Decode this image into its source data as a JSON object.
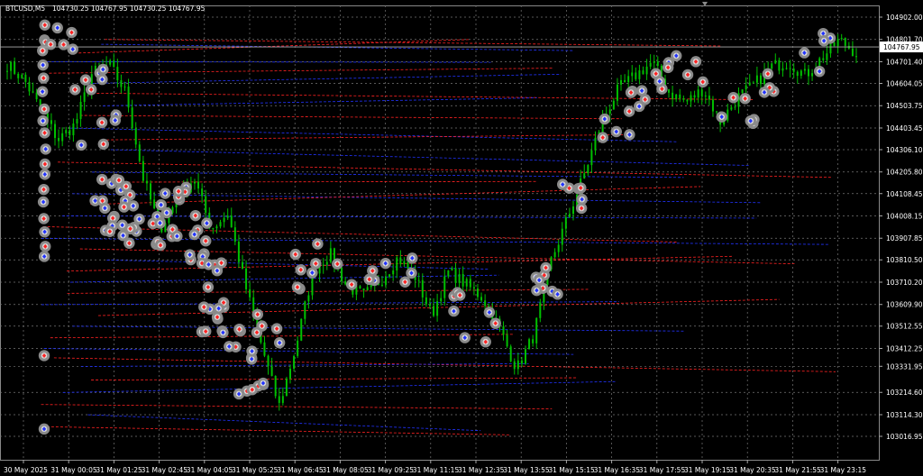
{
  "header": {
    "symbol": "BTCUSD,M5",
    "ohlc": "104730.25 104767.95 104730.25 104767.95"
  },
  "colors": {
    "background": "#000000",
    "grid": "#777777",
    "candle": "#00c000",
    "buy_line": "#2233ff",
    "sell_line": "#ff2222",
    "marker_ring": "#8a8a8a",
    "bid_line": "#aaaaaa"
  },
  "chart_data": {
    "type": "candlestick",
    "symbol": "BTCUSD",
    "timeframe": "M5",
    "current_price": 104767.95,
    "price_label": "104767.95",
    "ylim": [
      103016.95,
      104902.0
    ],
    "y_ticks": [
      "104902.00",
      "104801.70",
      "104701.40",
      "104604.05",
      "104503.75",
      "104403.45",
      "104306.10",
      "104205.80",
      "104108.45",
      "104008.15",
      "103907.85",
      "103810.50",
      "103710.20",
      "103609.90",
      "103512.55",
      "103412.25",
      "103331.95",
      "103214.60",
      "103114.30",
      "103016.95"
    ],
    "x_ticks": [
      "30 May 2025",
      "31 May 00:05",
      "31 May 01:25",
      "31 May 02:45",
      "31 May 04:05",
      "31 May 05:25",
      "31 May 06:45",
      "31 May 08:05",
      "31 May 09:25",
      "31 May 11:15",
      "31 May 12:35",
      "31 May 13:55",
      "31 May 15:15",
      "31 May 16:35",
      "31 May 17:55",
      "31 May 19:15",
      "31 May 20:35",
      "31 May 21:55",
      "31 May 23:15"
    ],
    "grid": true,
    "price_path": [
      104690,
      104620,
      104480,
      104350,
      104420,
      104650,
      104690,
      104560,
      104180,
      103950,
      104080,
      104180,
      103950,
      104020,
      103700,
      103420,
      103150,
      103420,
      103760,
      103840,
      103690,
      103650,
      103720,
      103820,
      103740,
      103560,
      103760,
      103700,
      103640,
      103500,
      103320,
      103470,
      103800,
      104000,
      104200,
      104430,
      104580,
      104640,
      104700,
      104560,
      104520,
      104580,
      104430,
      104540,
      104600,
      104680,
      104700,
      104640,
      104720,
      104800,
      104740
    ],
    "trade_markers": {
      "description": "Grey circular trade markers with red/blue arrows connected by dashed red and blue trade lines",
      "approximate_count": 300
    }
  }
}
